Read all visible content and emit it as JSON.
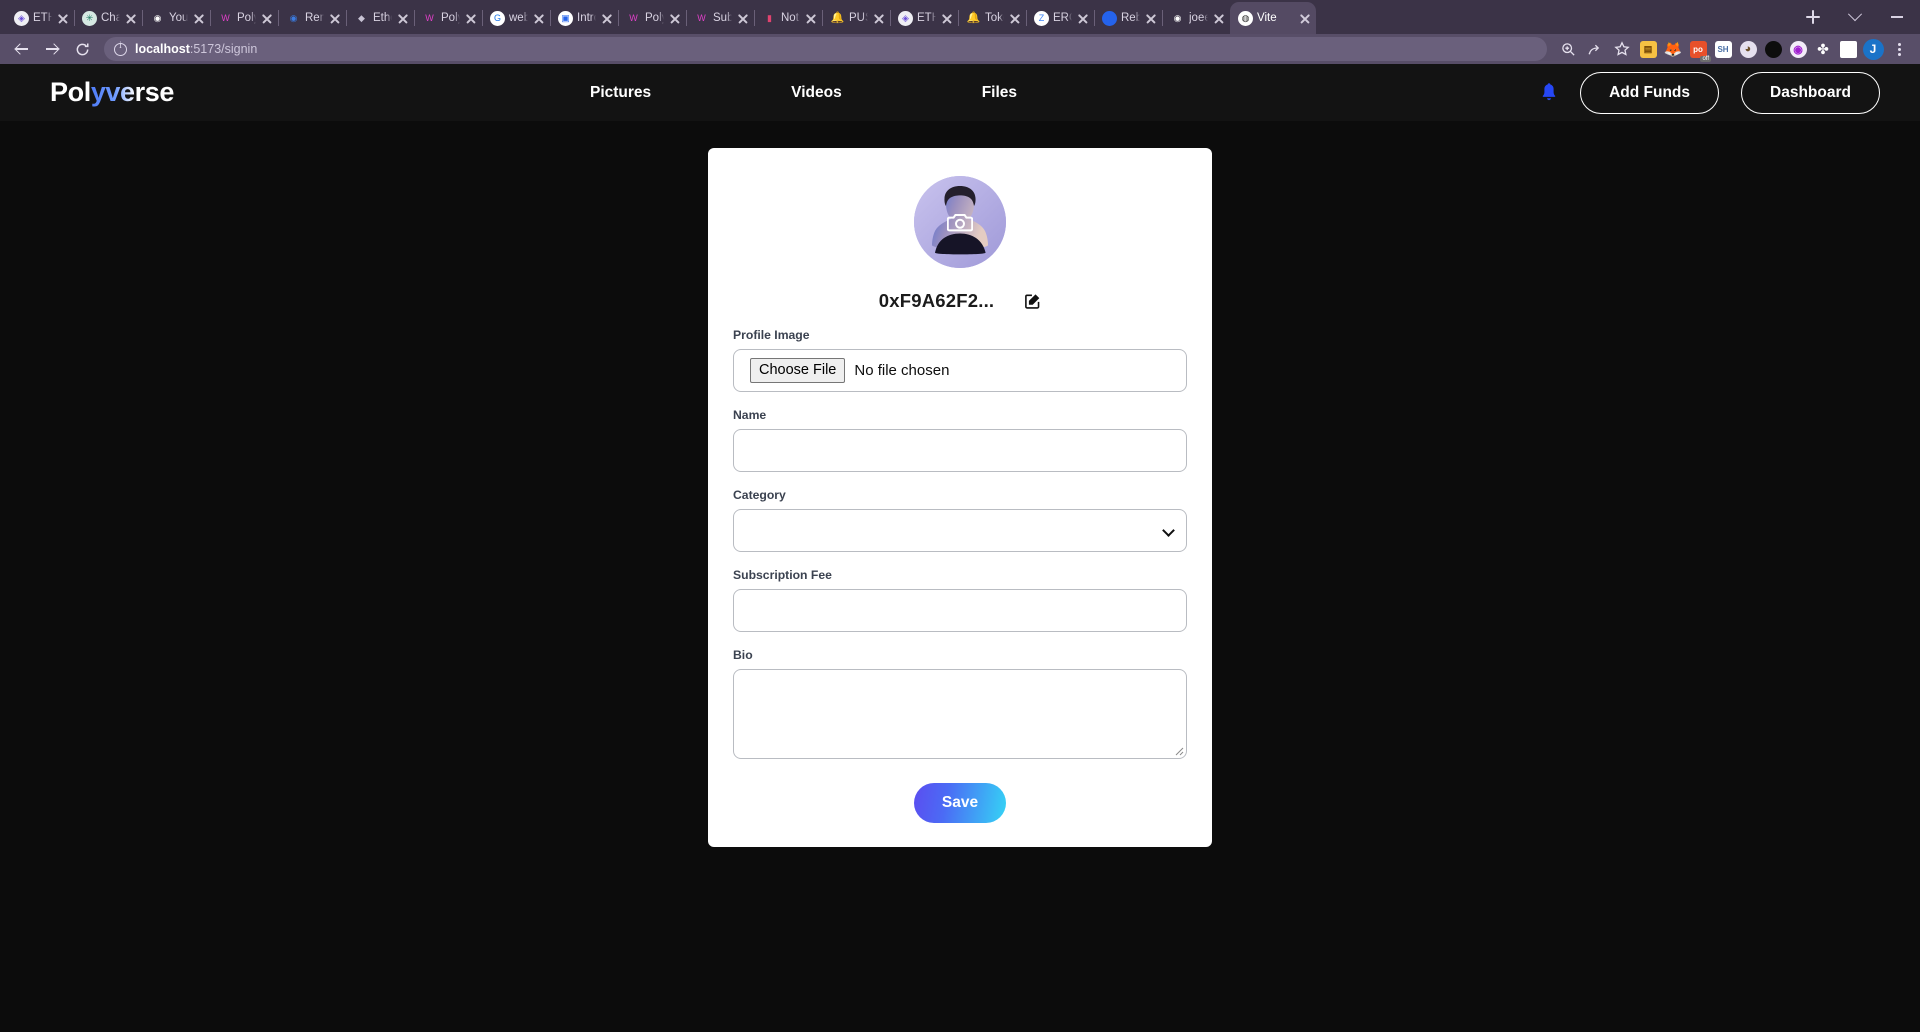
{
  "browser": {
    "tabs": [
      {
        "title": "ETH",
        "favicon": "eth-icon",
        "color": "#efeff4",
        "glyph": "◈",
        "glyph_color": "#6b4fd8"
      },
      {
        "title": "Chat",
        "favicon": "chatgpt-icon",
        "color": "#d6e9e3",
        "glyph": "✳",
        "glyph_color": "#1f7a63"
      },
      {
        "title": "Your",
        "favicon": "github-icon",
        "color": "#3b3347",
        "glyph": "◉",
        "glyph_color": "#ffffff"
      },
      {
        "title": "Poly",
        "favicon": "polyverse-icon",
        "color": "#3b3347",
        "glyph": "W",
        "glyph_color": "#e040c8"
      },
      {
        "title": "Rem",
        "favicon": "remix-icon",
        "color": "#3b3347",
        "glyph": "◉",
        "glyph_color": "#3b7be0"
      },
      {
        "title": "Ethe",
        "favicon": "etherscan-icon",
        "color": "#3b3347",
        "glyph": "◆",
        "glyph_color": "#c8c3d4"
      },
      {
        "title": "Poly",
        "favicon": "polyverse-icon",
        "color": "#3b3347",
        "glyph": "W",
        "glyph_color": "#e040c8"
      },
      {
        "title": "web",
        "favicon": "google-icon",
        "color": "#ffffff",
        "glyph": "G",
        "glyph_color": "#1a73e8"
      },
      {
        "title": "Intro",
        "favicon": "video-icon",
        "color": "#ffffff",
        "glyph": "▣",
        "glyph_color": "#2563eb"
      },
      {
        "title": "Poly",
        "favicon": "polyverse-icon",
        "color": "#3b3347",
        "glyph": "W",
        "glyph_color": "#e040c8"
      },
      {
        "title": "Subs",
        "favicon": "polyverse-icon",
        "color": "#3b3347",
        "glyph": "W",
        "glyph_color": "#e040c8"
      },
      {
        "title": "Noti",
        "favicon": "notion-icon",
        "color": "#3b3347",
        "glyph": "▮",
        "glyph_color": "#e0436f"
      },
      {
        "title": "PUS",
        "favicon": "push-bell-icon",
        "color": "#3b3347",
        "glyph": "🔔",
        "glyph_color": "#e040c8"
      },
      {
        "title": "ETH",
        "favicon": "eth-icon",
        "color": "#efeff4",
        "glyph": "◈",
        "glyph_color": "#6b4fd8"
      },
      {
        "title": "Toke",
        "favicon": "push-bell-icon",
        "color": "#3b3347",
        "glyph": "🔔",
        "glyph_color": "#e040c8"
      },
      {
        "title": "ERC",
        "favicon": "zora-icon",
        "color": "#ffffff",
        "glyph": "Z",
        "glyph_color": "#3b82f6"
      },
      {
        "title": "Reb",
        "favicon": "blue-doc-icon",
        "color": "#2563eb",
        "glyph": "▌",
        "glyph_color": "#2563eb"
      },
      {
        "title": "joee",
        "favicon": "github-icon",
        "color": "#3b3347",
        "glyph": "◉",
        "glyph_color": "#ffffff"
      },
      {
        "title": "Vite",
        "favicon": "vite-globe-icon",
        "color": "#ffffff",
        "glyph": "◍",
        "glyph_color": "#2a2a2a",
        "active": true
      }
    ],
    "new_tab_label": "New tab",
    "window_controls": {
      "tab_search": "chevron-down-icon",
      "minimize": "minimize-icon"
    },
    "nav": {
      "back": "back-arrow-icon",
      "forward": "forward-arrow-icon",
      "reload": "reload-icon"
    },
    "url": {
      "host": "localhost",
      "path": ":5173/signin",
      "full": "localhost:5173/signin"
    },
    "toolbar_icons": [
      {
        "name": "zoom-search-icon",
        "glyph": "⌕"
      },
      {
        "name": "share-icon",
        "glyph": "↗"
      },
      {
        "name": "bookmark-star-icon",
        "glyph": "☆"
      }
    ],
    "extensions": [
      {
        "name": "wallet-extension-icon",
        "glyph": "▤",
        "bg": "#f6c143",
        "fg": "#6b3f00"
      },
      {
        "name": "metamask-extension-icon",
        "glyph": "🦊",
        "bg": "#584e68",
        "fg": "#e8821e"
      },
      {
        "name": "adblock-extension-icon",
        "glyph": "po",
        "bg": "#e8502a",
        "fg": "#ffffff",
        "badge": "off"
      },
      {
        "name": "sh-extension-icon",
        "glyph": "SH",
        "bg": "#ffffff",
        "fg": "#4a6fa5"
      },
      {
        "name": "profile-extension-icon",
        "glyph": "◕",
        "bg": "#e8e3f0",
        "fg": "#6b4f2a"
      },
      {
        "name": "black-hole-extension-icon",
        "glyph": "⬤",
        "bg": "#584e68",
        "fg": "#0d0d0d"
      },
      {
        "name": "purple-extension-icon",
        "glyph": "◉",
        "bg": "#f0eaf6",
        "fg": "#a020d0"
      },
      {
        "name": "puzzle-extensions-icon",
        "glyph": "✤",
        "bg": "#584e68",
        "fg": "#ffffff"
      },
      {
        "name": "square-extension-icon",
        "glyph": "◻",
        "bg": "#584e68",
        "fg": "#ffffff"
      }
    ],
    "profile_initial": "J",
    "menu": "chrome-menu-icon"
  },
  "site": {
    "logo": {
      "part1": "Pol",
      "part2": "yve",
      "part3": "rse",
      "full": "Polyverse"
    },
    "nav": [
      {
        "label": "Pictures"
      },
      {
        "label": "Videos"
      },
      {
        "label": "Files"
      }
    ],
    "notifications_icon": "bell-icon",
    "buttons": {
      "add_funds": "Add Funds",
      "dashboard": "Dashboard"
    },
    "accent_blue": "#2647f5",
    "header_bg": "#131313"
  },
  "profile_card": {
    "avatar": {
      "alt": "user-avatar",
      "overlay_icon": "camera-icon"
    },
    "wallet_address": "0xF9A62F2...",
    "edit_icon": "edit-pencil-icon",
    "fields": [
      {
        "key": "profile_image",
        "label": "Profile Image",
        "type": "file",
        "button_label": "Choose File",
        "status": "No file chosen",
        "value": ""
      },
      {
        "key": "name",
        "label": "Name",
        "type": "text",
        "value": "",
        "placeholder": ""
      },
      {
        "key": "category",
        "label": "Category",
        "type": "select",
        "value": "",
        "options": []
      },
      {
        "key": "subscription_fee",
        "label": "Subscription Fee",
        "type": "text",
        "value": "",
        "placeholder": ""
      },
      {
        "key": "bio",
        "label": "Bio",
        "type": "textarea",
        "value": "",
        "placeholder": ""
      }
    ],
    "save_label": "Save",
    "save_gradient_from": "#5b4df0",
    "save_gradient_to": "#35d4f5"
  }
}
